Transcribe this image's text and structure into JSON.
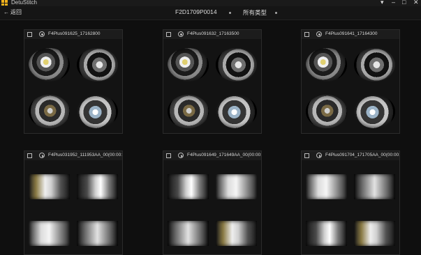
{
  "app": {
    "title": "DetuStitch",
    "icon": "app-logo-icon",
    "accent": "#f2b21b",
    "window_controls": [
      "chevron-down-icon",
      "minimize-icon",
      "maximize-icon",
      "close-icon"
    ]
  },
  "nav": {
    "back_label": "返回",
    "device_id": "F2D1709P0014",
    "filter_label": "所有类型"
  },
  "cards": [
    {
      "name": "F4Plus091625_17162800",
      "mode_icon": "camera-mode-icon"
    },
    {
      "name": "F4Plus091632_17163500",
      "mode_icon": "camera-mode-icon"
    },
    {
      "name": "F4Plus091641_17164300",
      "mode_icon": "camera-mode-icon"
    },
    {
      "name": "F4Plus031952_111953AA_00(00:00:1",
      "mode_icon": "video-play-icon"
    },
    {
      "name": "F4Plus091649_171649AA_00(00:00:1(",
      "mode_icon": "video-play-icon"
    },
    {
      "name": "F4Plus091704_171705AA_00(00:00:0",
      "mode_icon": "video-play-icon"
    }
  ]
}
